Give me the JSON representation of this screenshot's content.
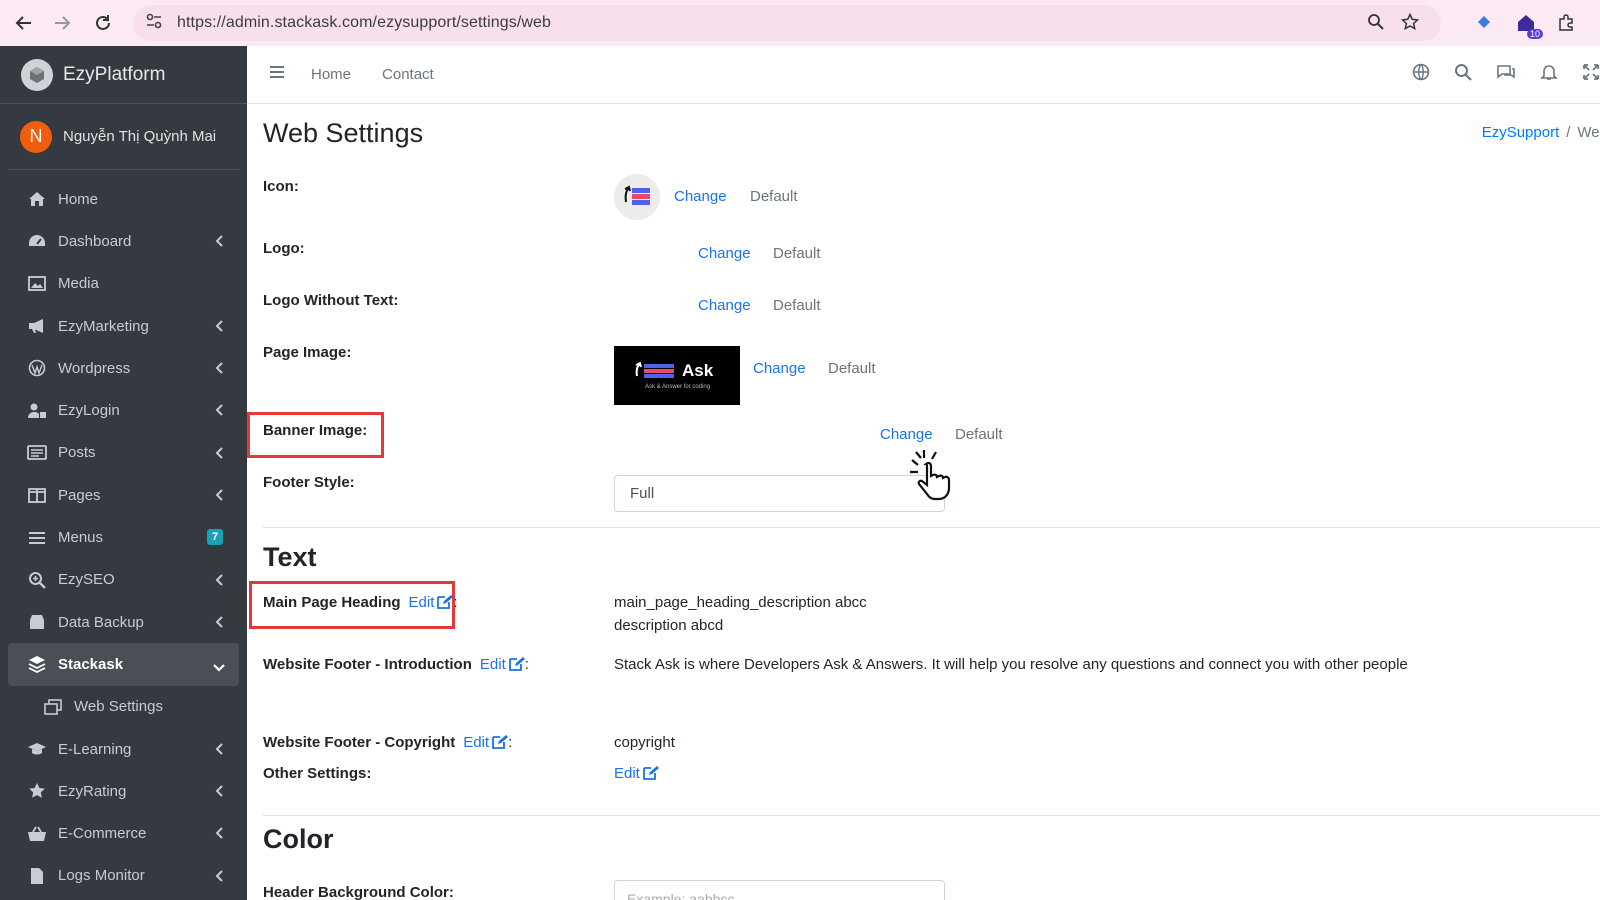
{
  "browser": {
    "url": "https://admin.stackask.com/ezysupport/settings/web",
    "extension_badge": "10"
  },
  "sidebar": {
    "brand": "EzyPlatform",
    "user": {
      "initial": "N",
      "name": "Nguyễn Thị Quỳnh Mai"
    },
    "items": [
      {
        "label": "Home"
      },
      {
        "label": "Dashboard"
      },
      {
        "label": "Media"
      },
      {
        "label": "EzyMarketing"
      },
      {
        "label": "Wordpress"
      },
      {
        "label": "EzyLogin"
      },
      {
        "label": "Posts"
      },
      {
        "label": "Pages"
      },
      {
        "label": "Menus",
        "badge": "7"
      },
      {
        "label": "EzySEO"
      },
      {
        "label": "Data Backup"
      },
      {
        "label": "Stackask"
      },
      {
        "label": "Web Settings"
      },
      {
        "label": "E-Learning"
      },
      {
        "label": "EzyRating"
      },
      {
        "label": "E-Commerce"
      },
      {
        "label": "Logs Monitor"
      }
    ]
  },
  "topnav": {
    "home": "Home",
    "contact": "Contact"
  },
  "page": {
    "title": "Web Settings",
    "breadcrumb": {
      "parent": "EzySupport",
      "sep": "/",
      "current": "Web"
    },
    "change": "Change",
    "default": "Default",
    "edit": "Edit",
    "labels": {
      "icon": "Icon:",
      "logo": "Logo:",
      "logo_no_text": "Logo Without Text:",
      "page_image": "Page Image:",
      "banner_image": "Banner Image:",
      "footer_style": "Footer Style:"
    },
    "page_image_preview": {
      "title": "Ask",
      "subtitle": "Ask & Answer for coding"
    },
    "footer_style_value": "Full",
    "text_section": {
      "title": "Text",
      "main_heading_label": "Main Page Heading",
      "main_heading_value_line1": "main_page_heading_description abcc",
      "main_heading_value_line2": "description abcd",
      "footer_intro_label": "Website Footer - Introduction",
      "footer_intro_value": "Stack Ask is where Developers Ask & Answers. It will help you resolve any questions and connect you with other people",
      "footer_copyright_label": "Website Footer - Copyright",
      "footer_copyright_value": "copyright",
      "other_settings_label": "Other Settings:"
    },
    "color_section": {
      "title": "Color",
      "header_bg_label": "Header Background Color:",
      "header_bg_placeholder": "Example: aabbcc"
    }
  },
  "colors": {
    "sidebar_bg": "#343a40",
    "link": "#1a73e8",
    "highlight": "#e53935"
  }
}
